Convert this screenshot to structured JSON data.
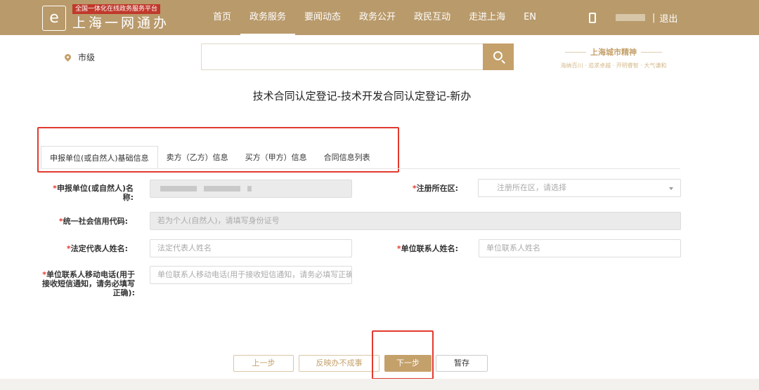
{
  "header": {
    "logo_tagline": "全国一体化在线政务服务平台",
    "logo_name": "上海一网通办",
    "nav": [
      {
        "label": "首页",
        "active": false
      },
      {
        "label": "政务服务",
        "active": true
      },
      {
        "label": "要闻动态",
        "active": false
      },
      {
        "label": "政务公开",
        "active": false
      },
      {
        "label": "政民互动",
        "active": false
      },
      {
        "label": "走进上海",
        "active": false
      },
      {
        "label": "EN",
        "active": false
      }
    ],
    "separator": "|",
    "logout": "退出"
  },
  "search": {
    "location": "市级",
    "placeholder": ""
  },
  "slogan": {
    "title": "上海城市精神",
    "subtitle": "海纳百川 · 追求卓越 · 开明睿智 · 大气谦和"
  },
  "page_title": "技术合同认定登记-技术开发合同认定登记-新办",
  "tabs": [
    {
      "label": "申报单位(或自然人)基础信息",
      "active": true
    },
    {
      "label": "卖方（乙方）信息",
      "active": false
    },
    {
      "label": "买方（甲方）信息",
      "active": false
    },
    {
      "label": "合同信息列表",
      "active": false
    }
  ],
  "form": {
    "applicant_name_label": "申报单位(或自然人)名称:",
    "district_label": "注册所在区:",
    "district_placeholder": "注册所在区，请选择",
    "credit_code_label": "统一社会信用代码:",
    "credit_code_placeholder": "若为个人(自然人)，请填写身份证号",
    "legal_rep_label": "法定代表人姓名:",
    "legal_rep_placeholder": "法定代表人姓名",
    "contact_name_label": "单位联系人姓名:",
    "contact_name_placeholder": "单位联系人姓名",
    "contact_phone_label": "单位联系人移动电话(用于接收短信通知，请务必填写正确):",
    "contact_phone_placeholder": "单位联系人移动电话(用于接收短信通知，请务必填写正确)",
    "required_mark": "*"
  },
  "buttons": {
    "prev": "上一步",
    "report": "反映办不成事",
    "next": "下一步",
    "save": "暂存"
  },
  "colors": {
    "header_bg": "#b99a6b",
    "accent": "#c4a06a",
    "highlight": "#e23a2e"
  }
}
